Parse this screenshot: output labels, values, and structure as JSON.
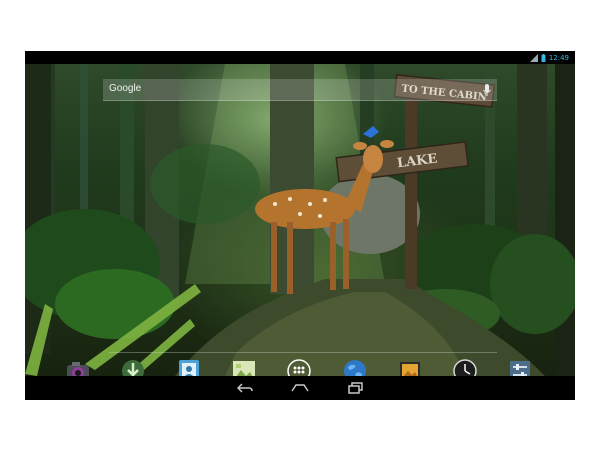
{
  "status_bar": {
    "time": "12:49",
    "icons": [
      "signal-icon",
      "battery-icon"
    ]
  },
  "search": {
    "label": "Google",
    "icon": "mic-icon"
  },
  "wallpaper": {
    "sign_top": "TO THE CABIN",
    "sign_bottom": "LAKE"
  },
  "hotseat": {
    "apps": [
      {
        "name": "camera-icon"
      },
      {
        "name": "downloads-icon"
      },
      {
        "name": "contacts-icon"
      },
      {
        "name": "gallery-icon"
      },
      {
        "name": "all-apps-icon"
      },
      {
        "name": "browser-icon"
      },
      {
        "name": "photos-icon"
      },
      {
        "name": "clock-icon"
      },
      {
        "name": "settings-icon"
      }
    ]
  },
  "nav_bar": {
    "buttons": [
      "back-icon",
      "home-icon",
      "recents-icon"
    ]
  },
  "colors": {
    "status_accent": "#33b5e5",
    "forest_dark": "#17230f",
    "forest_light": "#8fbf5a"
  }
}
